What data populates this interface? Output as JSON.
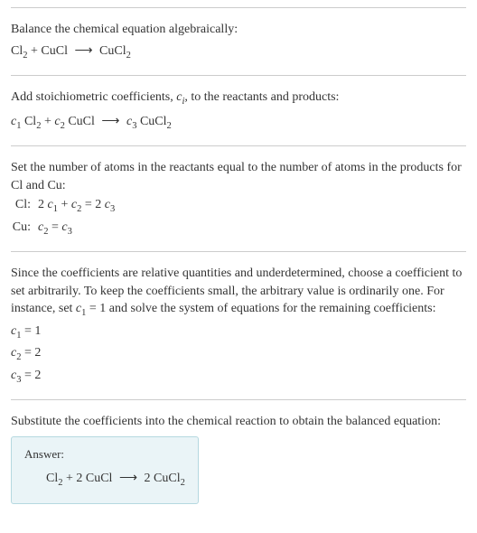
{
  "section1": {
    "intro": "Balance the chemical equation algebraically:",
    "eq_lhs1": "Cl",
    "eq_lhs1_sub": "2",
    "plus": " + ",
    "eq_lhs2": "CuCl",
    "arrow": "⟶",
    "eq_rhs": "CuCl",
    "eq_rhs_sub": "2"
  },
  "section2": {
    "intro_a": "Add stoichiometric coefficients, ",
    "intro_ci": "c",
    "intro_ci_sub": "i",
    "intro_b": ", to the reactants and products:",
    "c1": "c",
    "c1_sub": "1",
    "sp": " ",
    "r1": "Cl",
    "r1_sub": "2",
    "plus": " + ",
    "c2": "c",
    "c2_sub": "2",
    "r2": "CuCl",
    "arrow": "⟶",
    "c3": "c",
    "c3_sub": "3",
    "r3": "CuCl",
    "r3_sub": "2"
  },
  "section3": {
    "intro": "Set the number of atoms in the reactants equal to the number of atoms in the products for Cl and Cu:",
    "row1_label": "Cl:",
    "row1_a": "2 ",
    "row1_c1": "c",
    "row1_c1_sub": "1",
    "row1_plus": " + ",
    "row1_c2": "c",
    "row1_c2_sub": "2",
    "row1_eq": " = 2 ",
    "row1_c3": "c",
    "row1_c3_sub": "3",
    "row2_label": "Cu:",
    "row2_c2": "c",
    "row2_c2_sub": "2",
    "row2_eq": " = ",
    "row2_c3": "c",
    "row2_c3_sub": "3"
  },
  "section4": {
    "intro_a": "Since the coefficients are relative quantities and underdetermined, choose a coefficient to set arbitrarily. To keep the coefficients small, the arbitrary value is ordinarily one. For instance, set ",
    "c1": "c",
    "c1_sub": "1",
    "intro_b": " = 1 and solve the system of equations for the remaining coefficients:",
    "line1_c": "c",
    "line1_sub": "1",
    "line1_val": " = 1",
    "line2_c": "c",
    "line2_sub": "2",
    "line2_val": " = 2",
    "line3_c": "c",
    "line3_sub": "3",
    "line3_val": " = 2"
  },
  "section5": {
    "intro": "Substitute the coefficients into the chemical reaction to obtain the balanced equation:",
    "answer_label": "Answer:",
    "eq_r1": "Cl",
    "eq_r1_sub": "2",
    "eq_plus1": " + 2 CuCl ",
    "arrow": "⟶",
    "eq_rhs": " 2 CuCl",
    "eq_rhs_sub": "2"
  }
}
